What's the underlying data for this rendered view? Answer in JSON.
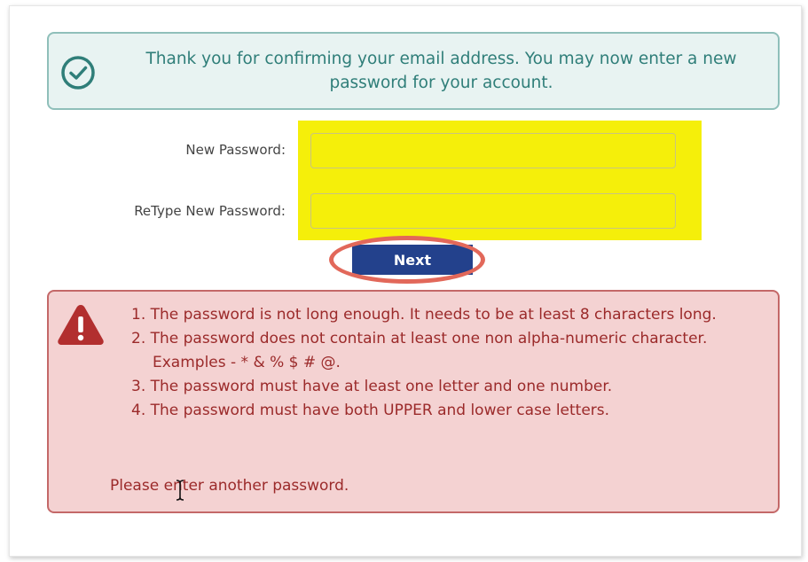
{
  "success": {
    "icon": "check-circle-icon",
    "message": "Thank you for confirming your email address. You may now enter a new password for your account."
  },
  "form": {
    "new_password_label": "New Password:",
    "new_password_value": "",
    "retype_password_label": "ReType New Password:",
    "retype_password_value": "",
    "next_label": "Next"
  },
  "error": {
    "icon": "warning-triangle-icon",
    "items": [
      "1. The password is not long enough. It needs to be at least 8 characters long.",
      "2. The password does not contain at least one non alpha-numeric character. Examples - * & % $ # @.",
      "3. The password must have at least one letter and one number.",
      "4. The password must have both UPPER and lower case letters."
    ],
    "footer": "Please enter another password."
  },
  "colors": {
    "success_border": "#8fbfba",
    "success_bg": "#e8f3f2",
    "success_text": "#2f7e79",
    "highlight": "#f5ef0a",
    "next_button": "#23418c",
    "annotation_circle": "#e2685a",
    "error_border": "#c46868",
    "error_bg": "#f4d2d2",
    "error_text": "#9b2a2a"
  }
}
